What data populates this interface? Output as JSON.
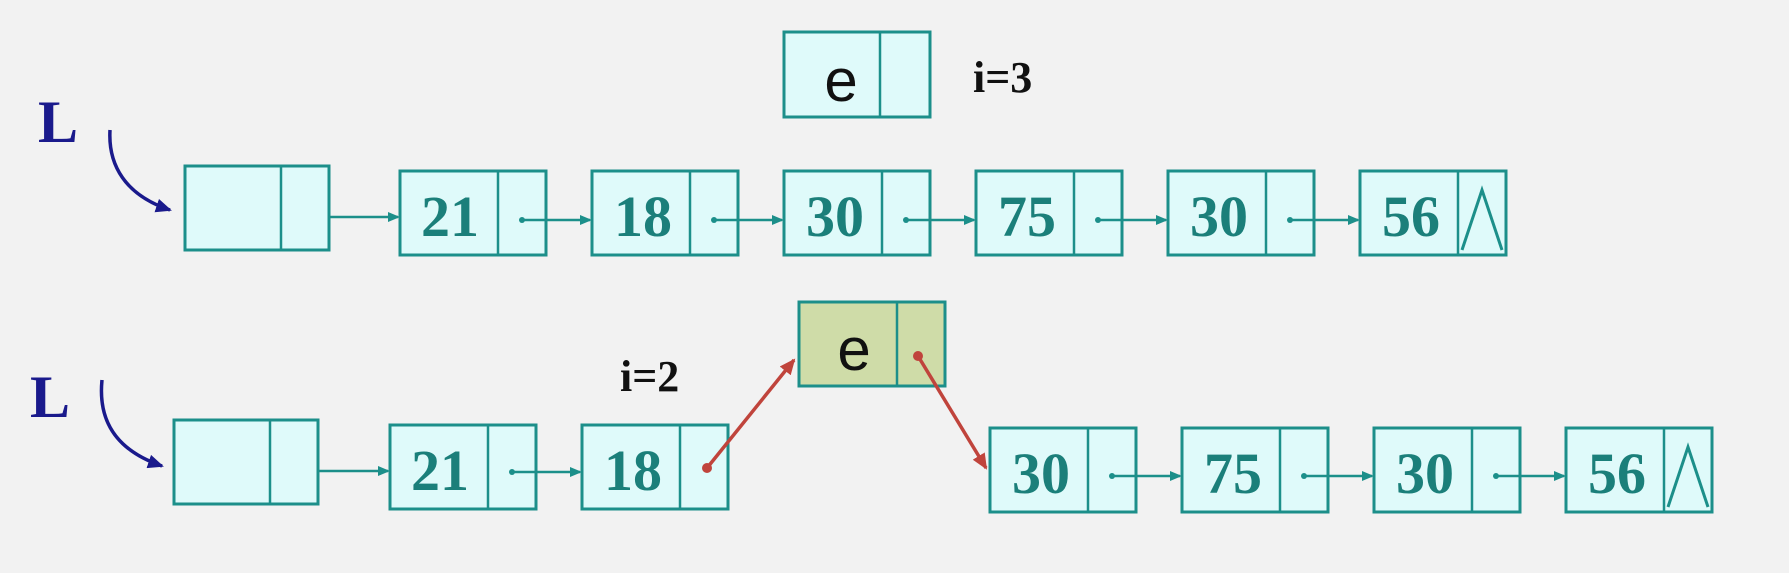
{
  "top": {
    "head_label": "L",
    "new_node_value": "e",
    "index_label": "i=3",
    "values": [
      "21",
      "18",
      "30",
      "75",
      "30",
      "56"
    ],
    "null_symbol": "∧"
  },
  "bottom": {
    "head_label": "L",
    "new_node_value": "e",
    "index_label": "i=2",
    "values": [
      "21",
      "18",
      "30",
      "75",
      "30",
      "56"
    ],
    "null_symbol": "∧"
  },
  "colors": {
    "node_fill": "#dffafa",
    "node_stroke": "#1c8f8a",
    "new_node_fill": "#cfdca8",
    "value_text": "#1b7f7a",
    "head_text": "#1a1a8c",
    "insert_link": "#c0443c"
  }
}
